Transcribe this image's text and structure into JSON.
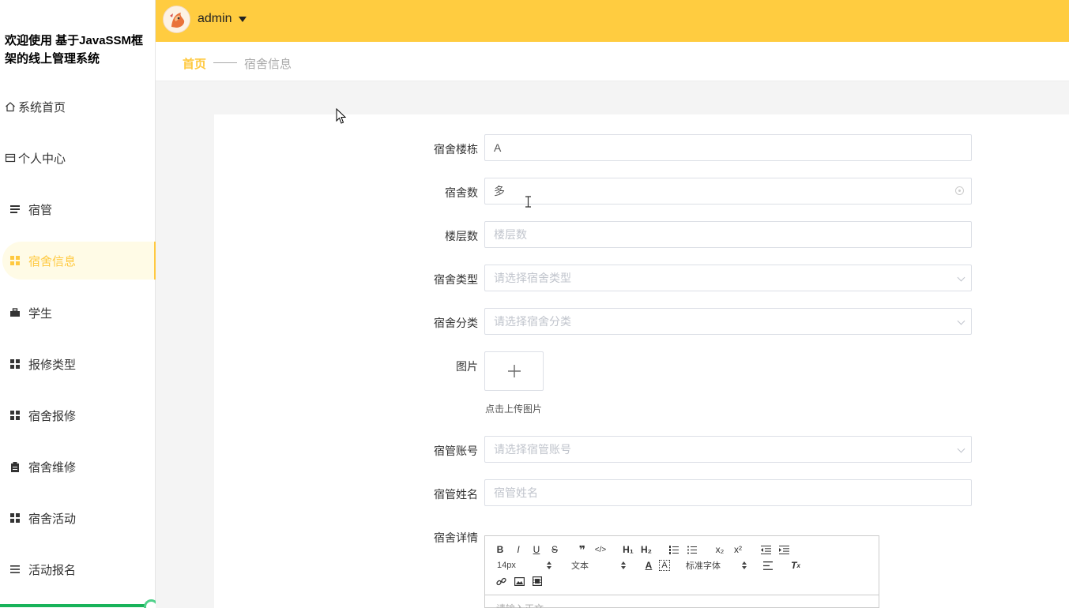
{
  "app": {
    "title": "欢迎使用 基于JavaSSM框架的线上管理系统"
  },
  "header": {
    "username": "admin"
  },
  "sidebar": {
    "items": [
      {
        "label": "系统首页",
        "icon": "home-icon"
      },
      {
        "label": "个人中心",
        "icon": "id-card-icon"
      },
      {
        "label": "宿管",
        "icon": "list-icon"
      },
      {
        "label": "宿舍信息",
        "icon": "grid-icon",
        "active": true
      },
      {
        "label": "学生",
        "icon": "briefcase-icon"
      },
      {
        "label": "报修类型",
        "icon": "grid-icon"
      },
      {
        "label": "宿舍报修",
        "icon": "grid-icon"
      },
      {
        "label": "宿舍维修",
        "icon": "clipboard-icon"
      },
      {
        "label": "宿舍活动",
        "icon": "grid-icon"
      },
      {
        "label": "活动报名",
        "icon": "list-icon"
      }
    ],
    "scroll_progress": 0.97
  },
  "breadcrumb": {
    "home": "首页",
    "current": "宿舍信息"
  },
  "form": {
    "building": {
      "label": "宿舍楼栋",
      "value": "A"
    },
    "room_count": {
      "label": "宿舍数",
      "value": "多"
    },
    "floors": {
      "label": "楼层数",
      "placeholder": "楼层数"
    },
    "room_type": {
      "label": "宿舍类型",
      "placeholder": "请选择宿舍类型"
    },
    "room_category": {
      "label": "宿舍分类",
      "placeholder": "请选择宿舍分类"
    },
    "image": {
      "label": "图片",
      "tip": "点击上传图片"
    },
    "manager_account": {
      "label": "宿管账号",
      "placeholder": "请选择宿管账号"
    },
    "manager_name": {
      "label": "宿管姓名",
      "placeholder": "宿管姓名"
    },
    "details": {
      "label": "宿舍详情",
      "font_size": "14px",
      "block_type": "文本",
      "font_family": "标准字体",
      "placeholder": "请输入正文..."
    }
  },
  "colors": {
    "accent": "#ffc940",
    "topbar": "#ffcc40",
    "active_bg": "#fffbe6",
    "progress": "#19b35a"
  }
}
